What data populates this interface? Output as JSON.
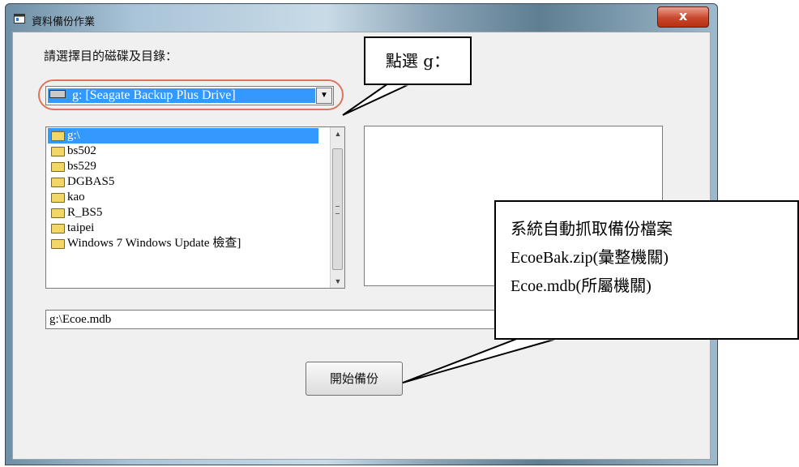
{
  "window": {
    "title": "資料備份作業",
    "close_label": "x"
  },
  "form": {
    "choose_label": "請選擇目的磁碟及目錄：",
    "drive_selected": "g: [Seagate Backup Plus Drive]",
    "directories": [
      "g:\\",
      "bs502",
      "bs529",
      "DGBAS5",
      "kao",
      "R_BS5",
      "taipei",
      "Windows 7 Windows Update 檢查]"
    ],
    "selected_directory_index": 0,
    "path_value": "g:\\Ecoe.mdb",
    "start_button": "開始備份"
  },
  "callouts": {
    "drive_hint": "點選 g：",
    "auto_lines": [
      "系統自動抓取備份檔案",
      "EcoeBak.zip(彙整機關)",
      "Ecoe.mdb(所屬機關)"
    ]
  },
  "colors": {
    "selection": "#3399ff",
    "highlight_ring": "#d9775a",
    "close_button": "#c9462c"
  }
}
